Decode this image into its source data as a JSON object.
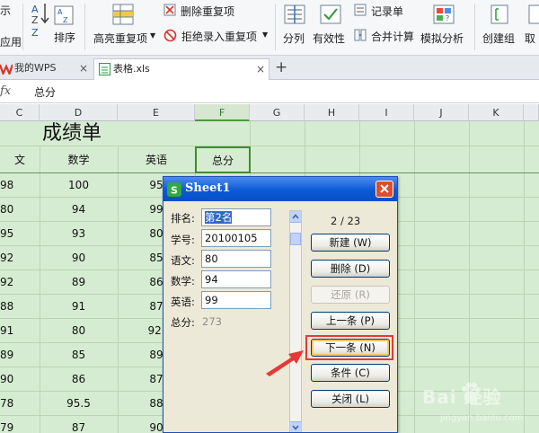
{
  "ribbon": {
    "left_partial_top": "示",
    "left_partial_bottom": "应用",
    "sort_label": "排序",
    "highlight_dup_label": "高亮重复项",
    "delete_dup_label": "删除重复项",
    "reject_dup_label": "拒绝录入重复项",
    "split_label": "分列",
    "validity_label": "有效性",
    "record_label": "记录单",
    "merge_calc_label": "合并计算",
    "simulate_label": "模拟分析",
    "create_group_label": "创建组",
    "cancel_partial_label": "取"
  },
  "tabs": [
    {
      "label": "我的WPS"
    },
    {
      "label": "表格.xls"
    }
  ],
  "formula_bar": {
    "fx": "fx",
    "content": "总分"
  },
  "columns": [
    "C",
    "D",
    "E",
    "F",
    "G",
    "H",
    "I",
    "J",
    "K"
  ],
  "sheet": {
    "title": "成绩单",
    "headers": [
      "文",
      "数学",
      "英语",
      "总分"
    ],
    "rows": [
      [
        "98",
        "100",
        "95"
      ],
      [
        "80",
        "94",
        "99"
      ],
      [
        "95",
        "93",
        "80"
      ],
      [
        "92",
        "90",
        "85"
      ],
      [
        "92",
        "89",
        "86"
      ],
      [
        "88",
        "91",
        "87"
      ],
      [
        "91",
        "80",
        "92."
      ],
      [
        "89",
        "85",
        "89"
      ],
      [
        "90",
        "86",
        "87"
      ],
      [
        "78",
        "95.5",
        "88"
      ],
      [
        "79",
        "87",
        "90"
      ]
    ]
  },
  "dialog": {
    "title": "Sheet1",
    "fields": [
      {
        "label": "排名:",
        "value": "第2名"
      },
      {
        "label": "学号:",
        "value": "20100105"
      },
      {
        "label": "语文:",
        "value": "80"
      },
      {
        "label": "数学:",
        "value": "94"
      },
      {
        "label": "英语:",
        "value": "99"
      }
    ],
    "total_label": "总分:",
    "total_value": "273",
    "record_counter": "2 / 23",
    "buttons": {
      "new": "新建 (W)",
      "delete": "删除 (D)",
      "restore": "还原 (R)",
      "prev": "上一条 (P)",
      "next": "下一条 (N)",
      "criteria": "条件 (C)",
      "close": "关闭 (L)"
    }
  },
  "watermark": {
    "brand": "Bai 经验",
    "url": "jingyan.baidu.com"
  },
  "colors": {
    "sheet_bg": "#d6ecd2",
    "dialog_title": "#0a5ad6",
    "arrow": "#e53935",
    "highlight": "#e53935"
  }
}
